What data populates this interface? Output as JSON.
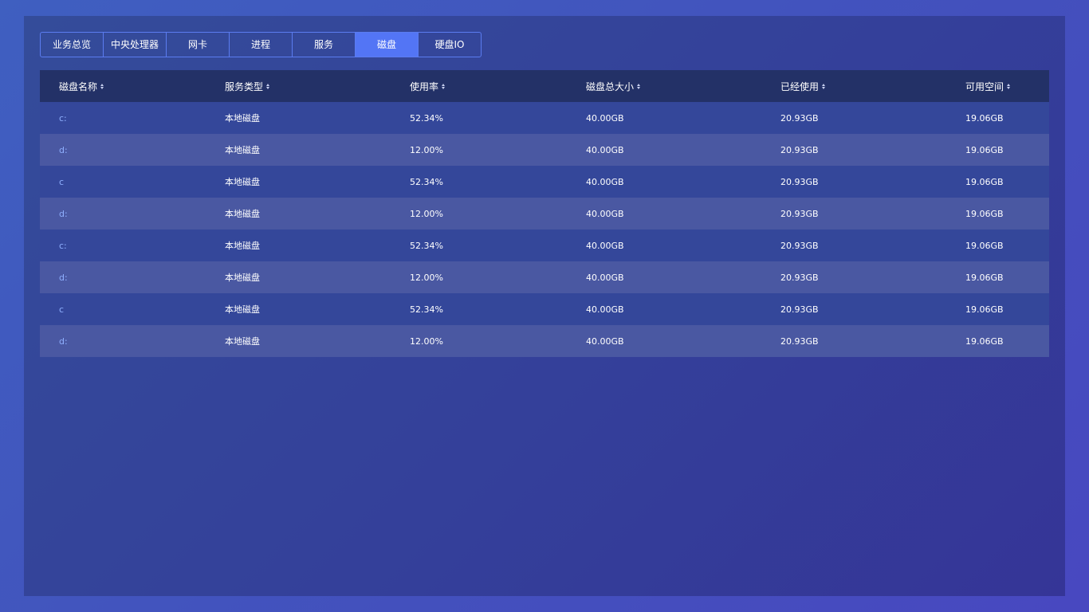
{
  "tabs": [
    {
      "label": "业务总览",
      "active": false
    },
    {
      "label": "中央处理器",
      "active": false
    },
    {
      "label": "网卡",
      "active": false
    },
    {
      "label": "进程",
      "active": false
    },
    {
      "label": "服务",
      "active": false
    },
    {
      "label": "磁盘",
      "active": true
    },
    {
      "label": "硬盘IO",
      "active": false
    }
  ],
  "table": {
    "columns": [
      "磁盘名称",
      "服务类型",
      "使用率",
      "磁盘总大小",
      "已经使用",
      "可用空间"
    ],
    "rows": [
      [
        "c:",
        "本地磁盘",
        "52.34%",
        "40.00GB",
        "20.93GB",
        "19.06GB"
      ],
      [
        "d:",
        "本地磁盘",
        "12.00%",
        "40.00GB",
        "20.93GB",
        "19.06GB"
      ],
      [
        "c",
        "本地磁盘",
        "52.34%",
        "40.00GB",
        "20.93GB",
        "19.06GB"
      ],
      [
        "d:",
        "本地磁盘",
        "12.00%",
        "40.00GB",
        "20.93GB",
        "19.06GB"
      ],
      [
        "c:",
        "本地磁盘",
        "52.34%",
        "40.00GB",
        "20.93GB",
        "19.06GB"
      ],
      [
        "d:",
        "本地磁盘",
        "12.00%",
        "40.00GB",
        "20.93GB",
        "19.06GB"
      ],
      [
        "c",
        "本地磁盘",
        "52.34%",
        "40.00GB",
        "20.93GB",
        "19.06GB"
      ],
      [
        "d:",
        "本地磁盘",
        "12.00%",
        "40.00GB",
        "20.93GB",
        "19.06GB"
      ]
    ]
  },
  "icons": {
    "sort": "sort-icon"
  },
  "colors": {
    "active_tab": "#5375f5",
    "header_bg": "#233167",
    "row_odd": "#34479a",
    "row_even": "#4a58a2",
    "name_link": "#8fb0ff"
  }
}
